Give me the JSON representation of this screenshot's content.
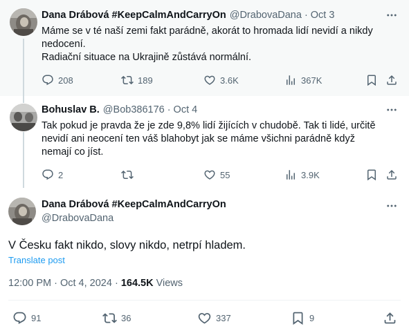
{
  "tweets": [
    {
      "name": "Dana Drábová #KeepCalmAndCarryOn",
      "handle": "@DrabovaDana",
      "date": "Oct 3",
      "text_lines": [
        "Máme se v té naší zemi fakt parádně, akorát to hromada lidí nevidí a nikdy",
        "nedocení.",
        "Radiační situace na Ukrajině zůstává normální."
      ],
      "replies": "208",
      "reposts": "189",
      "likes": "3.6K",
      "views": "367K"
    },
    {
      "name": "Bohuslav B.",
      "handle": "@Bob386176",
      "date": "Oct 4",
      "text_lines": [
        "Tak pokud je pravda že je zde 9,8% lidí žijících v chudobě. Tak ti lidé, určitě",
        "nevidí ani neocení ten váš blahobyt jak se máme všichni parádně když",
        "nemají co jíst."
      ],
      "replies": "2",
      "reposts": "",
      "likes": "55",
      "views": "3.9K"
    }
  ],
  "main": {
    "name": "Dana Drábová #KeepCalmAndCarryOn",
    "handle": "@DrabovaDana",
    "text": "V Česku fakt nikdo, slovy nikdo, netrpí hladem.",
    "translate": "Translate post",
    "time": "12:00 PM · Oct 4, 2024 · ",
    "views_count": "164.5K",
    "views_label": " Views",
    "replies": "91",
    "reposts": "36",
    "likes": "337",
    "bookmarks": "9"
  },
  "icons": [
    "reply-icon",
    "repost-icon",
    "like-icon",
    "views-icon",
    "bookmark-icon",
    "share-icon",
    "more-icon"
  ],
  "colors": {
    "text": "#0f1419",
    "secondary": "#536471",
    "link": "#1d9bf0",
    "highlight": "#f7f9f9"
  }
}
